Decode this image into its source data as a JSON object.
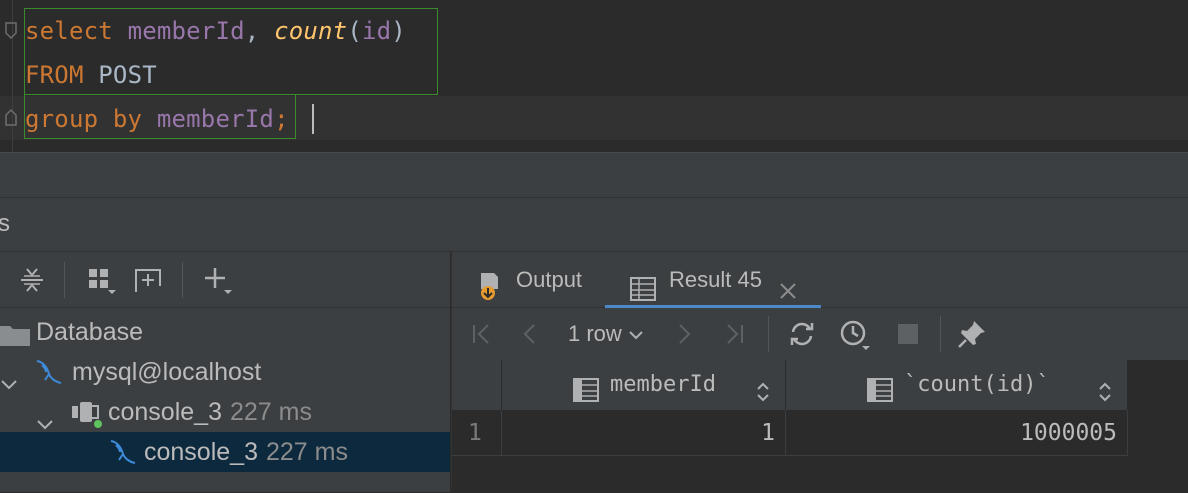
{
  "editor": {
    "line1": {
      "kw": "select",
      "col1": "memberId",
      "sep": ", ",
      "fn": "count",
      "open": "(",
      "arg": "id",
      "close": ")"
    },
    "line2": {
      "kw": "FROM",
      "table": "POST"
    },
    "line3": {
      "kw": "group by",
      "col": "memberId",
      "semi": ";"
    }
  },
  "services_partial_label": "s",
  "tree": [
    {
      "label": "Database",
      "time": "",
      "icon": "folder-icon"
    },
    {
      "label": "mysql@localhost",
      "time": "",
      "icon": "mysql-dolphin-icon"
    },
    {
      "label": "console_3",
      "time": "227 ms",
      "icon": "console-session-icon"
    },
    {
      "label": "console_3",
      "time": "227 ms",
      "icon": "mysql-dolphin-icon"
    }
  ],
  "tabs": [
    {
      "label": "Output",
      "icon": "output-icon"
    },
    {
      "label": "Result 45",
      "icon": "table-icon"
    }
  ],
  "result_toolbar": {
    "rows": "1 row"
  },
  "result": {
    "columns": [
      "memberId",
      "`count(id)`"
    ],
    "rows": [
      {
        "num": "1",
        "memberId": "1",
        "count": "1000005"
      }
    ]
  },
  "colors": {
    "keyword": "#cc7832",
    "column": "#9876aa",
    "function": "#ffc66d",
    "identifier": "#a9b7c6",
    "selection_border": "#3b8a2e",
    "selected_row": "#0d293e",
    "accent": "#4a88c7"
  }
}
